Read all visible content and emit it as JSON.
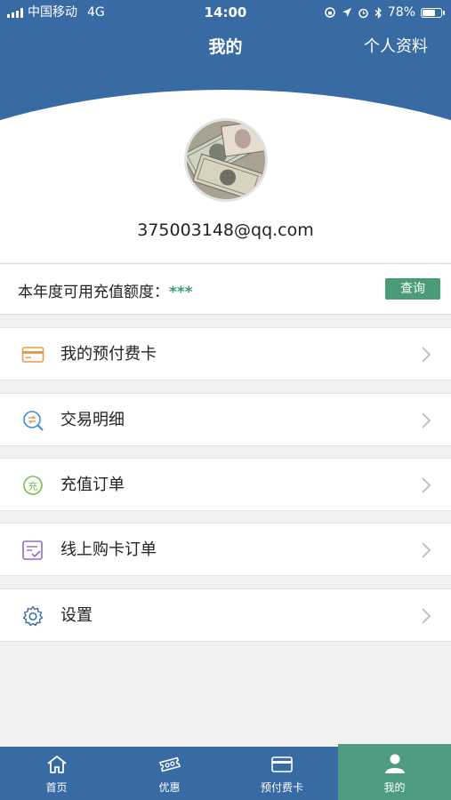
{
  "status_bar": {
    "carrier": "中国移动",
    "network": "4G",
    "time": "14:00",
    "battery": "78%",
    "battery_level": 0.78
  },
  "header": {
    "title": "我的",
    "profile_link": "个人资料"
  },
  "profile": {
    "email": "375003148@qq.com"
  },
  "quota": {
    "label": "本年度可用充值额度：",
    "value": "***",
    "query_button": "查询"
  },
  "menu": [
    {
      "label": "我的预付费卡",
      "icon": "card-icon",
      "color": "#e89a4e"
    },
    {
      "label": "交易明细",
      "icon": "transaction-search-icon",
      "color": "#3d8fd1"
    },
    {
      "label": "充值订单",
      "icon": "recharge-icon",
      "color": "#7cbd4a"
    },
    {
      "label": "线上购卡订单",
      "icon": "order-icon",
      "color": "#8e6cc5"
    },
    {
      "label": "设置",
      "icon": "gear-icon",
      "color": "#386aa4"
    }
  ],
  "tabs": [
    {
      "label": "首页",
      "icon": "home-icon"
    },
    {
      "label": "优惠",
      "icon": "ticket-icon"
    },
    {
      "label": "预付费卡",
      "icon": "card-icon"
    },
    {
      "label": "我的",
      "icon": "user-icon",
      "active": true
    }
  ],
  "colors": {
    "primary": "#386aa4",
    "accent": "#4a9c78",
    "background": "#f1f1f1"
  }
}
